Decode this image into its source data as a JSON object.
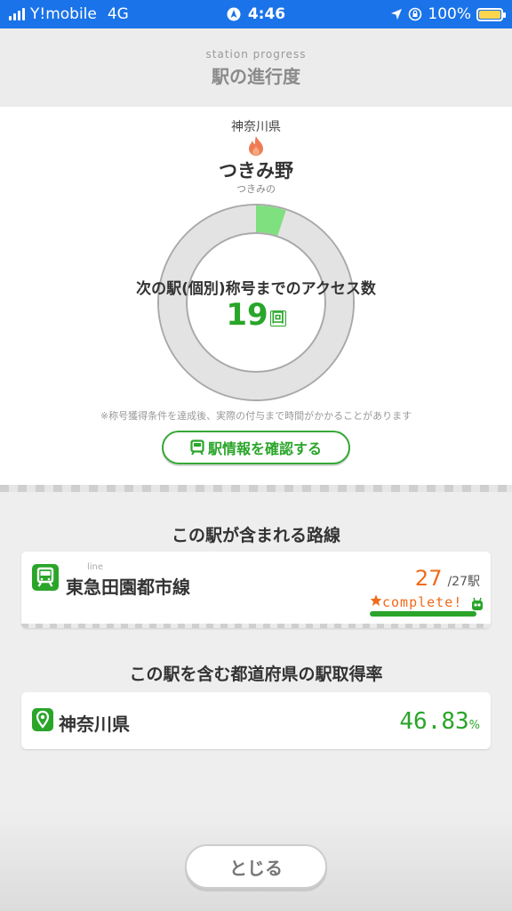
{
  "status_bar": {
    "carrier": "Y!mobile",
    "network": "4G",
    "time": "4:46",
    "battery": "100%"
  },
  "header": {
    "subtitle": "station progress",
    "title": "駅の進行度"
  },
  "station": {
    "prefecture": "神奈川県",
    "name": "つきみ野",
    "kana": "つきみの"
  },
  "progress": {
    "label": "次の駅(個別)称号までのアクセス数",
    "count": "19",
    "unit": "回",
    "fill_fraction": 0.05,
    "colors": {
      "fill": "#7ee07e",
      "track": "#e3e3e3",
      "ring": "#a9a9a9"
    }
  },
  "note": "※称号獲得条件を達成後、実際の付与まで時間がかかることがあります",
  "buttons": {
    "station_info": "駅情報を確認する",
    "close": "とじる"
  },
  "lines_section": {
    "title": "この駅が含まれる路線",
    "line_tag": "line",
    "line_name": "東急田園都市線",
    "obtained": "27",
    "total": "/27駅",
    "complete_label": "complete!"
  },
  "pref_section": {
    "title": "この駅を含む都道府県の駅取得率",
    "prefecture": "神奈川県",
    "rate": "46.83",
    "rate_unit": "%"
  },
  "colors": {
    "accent_green": "#2aa52a",
    "accent_orange": "#f06a1a",
    "status_bar": "#1a73e8"
  }
}
